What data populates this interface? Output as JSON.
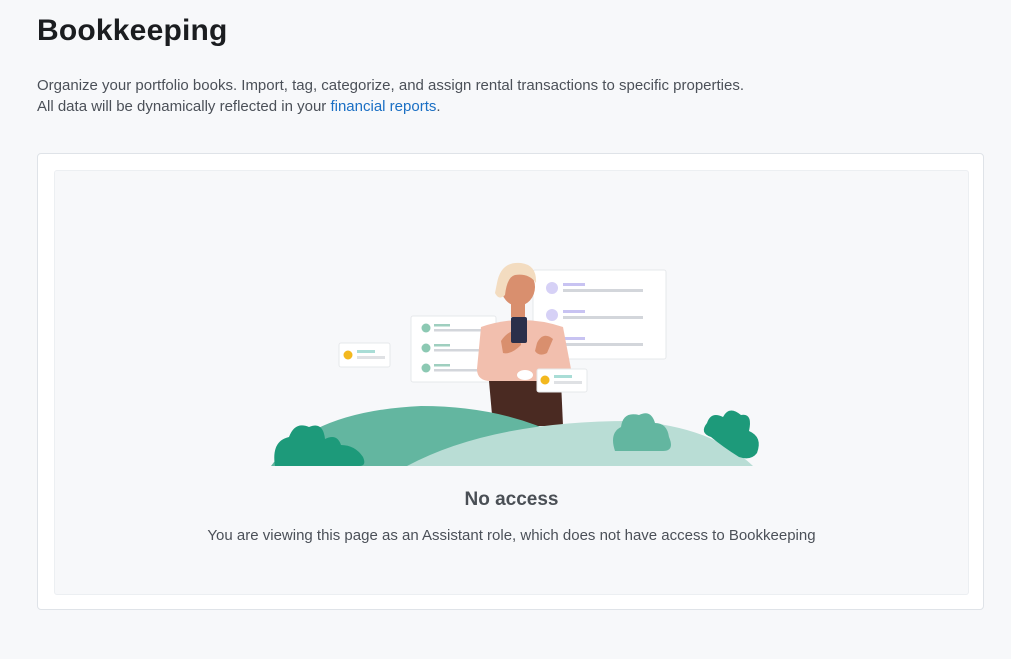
{
  "page": {
    "title": "Bookkeeping",
    "description_line1": "Organize your portfolio books. Import, tag, categorize, and assign rental transactions to specific properties.",
    "description_line2_prefix": "All data will be dynamically reflected in your ",
    "description_link": "financial reports",
    "description_line2_suffix": "."
  },
  "empty_state": {
    "title": "No access",
    "message": "You are viewing this page as an Assistant role, which does not have access to Bookkeeping",
    "illustration": "person-with-phone-and-lists-illustration"
  },
  "colors": {
    "link": "#1a6fc4",
    "hill_dark": "#1d9a7a",
    "hill_mid": "#63b6a0",
    "hill_light": "#b9ddd5",
    "accent_yellow": "#f3b81e",
    "accent_purple": "#cbc6f4"
  }
}
